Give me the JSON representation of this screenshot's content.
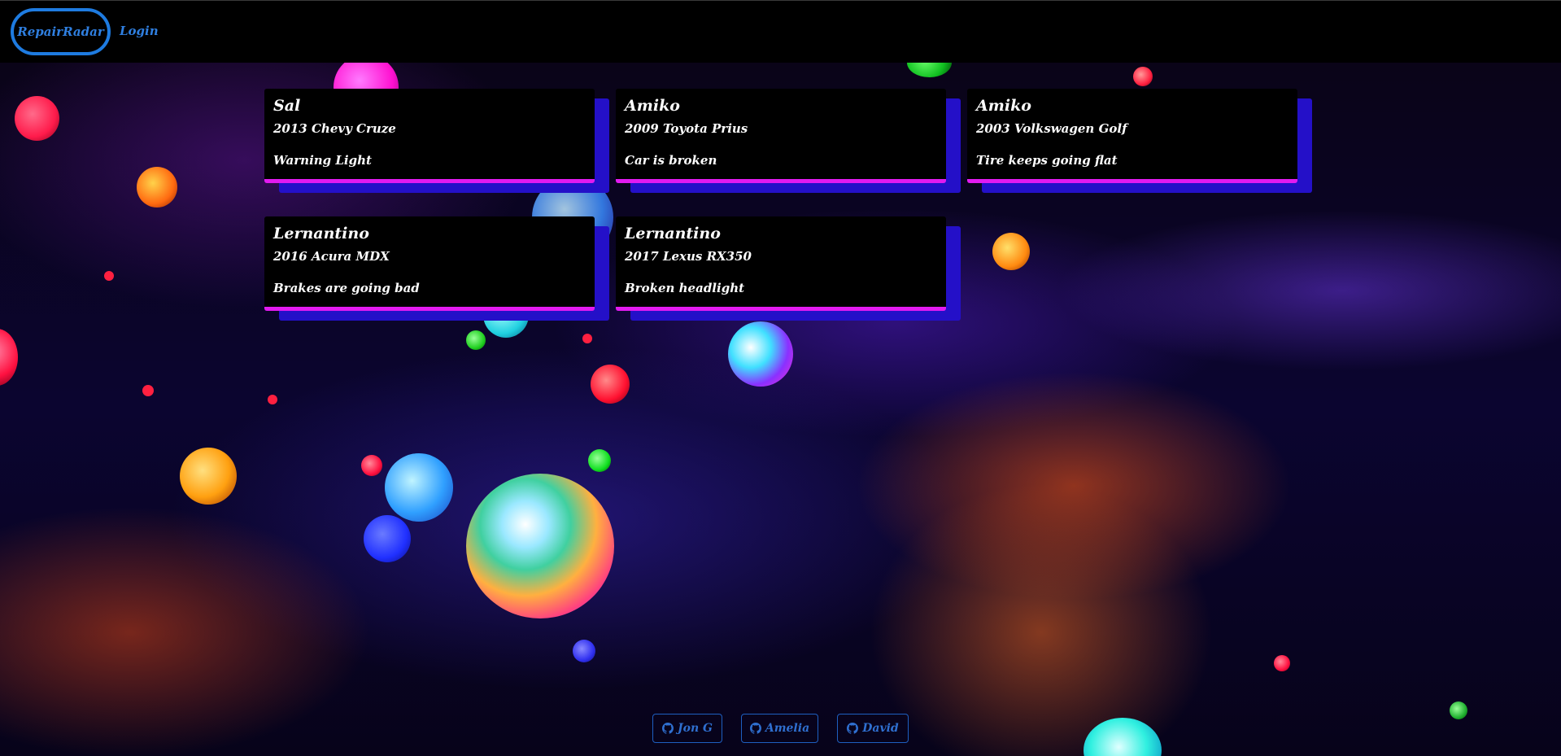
{
  "navbar": {
    "brand": "RepairRadar",
    "login": "Login"
  },
  "cards": [
    {
      "name": "Sal",
      "car": "2013 Chevy Cruze",
      "issue": "Warning Light"
    },
    {
      "name": "Amiko",
      "car": "2009 Toyota Prius",
      "issue": "Car is broken"
    },
    {
      "name": "Amiko",
      "car": "2003 Volkswagen Golf",
      "issue": "Tire keeps going flat"
    },
    {
      "name": "Lernantino",
      "car": "2016 Acura MDX",
      "issue": "Brakes are going bad"
    },
    {
      "name": "Lernantino",
      "car": "2017 Lexus RX350",
      "issue": "Broken headlight"
    }
  ],
  "footer": {
    "links": [
      {
        "label": "Jon G",
        "icon": "github-icon"
      },
      {
        "label": "Amelia",
        "icon": "github-icon"
      },
      {
        "label": "David",
        "icon": "github-icon"
      }
    ]
  },
  "colors": {
    "accent": "#1e7be0",
    "card_border": "#e21bf0",
    "card_shadow": "#2410c8"
  }
}
